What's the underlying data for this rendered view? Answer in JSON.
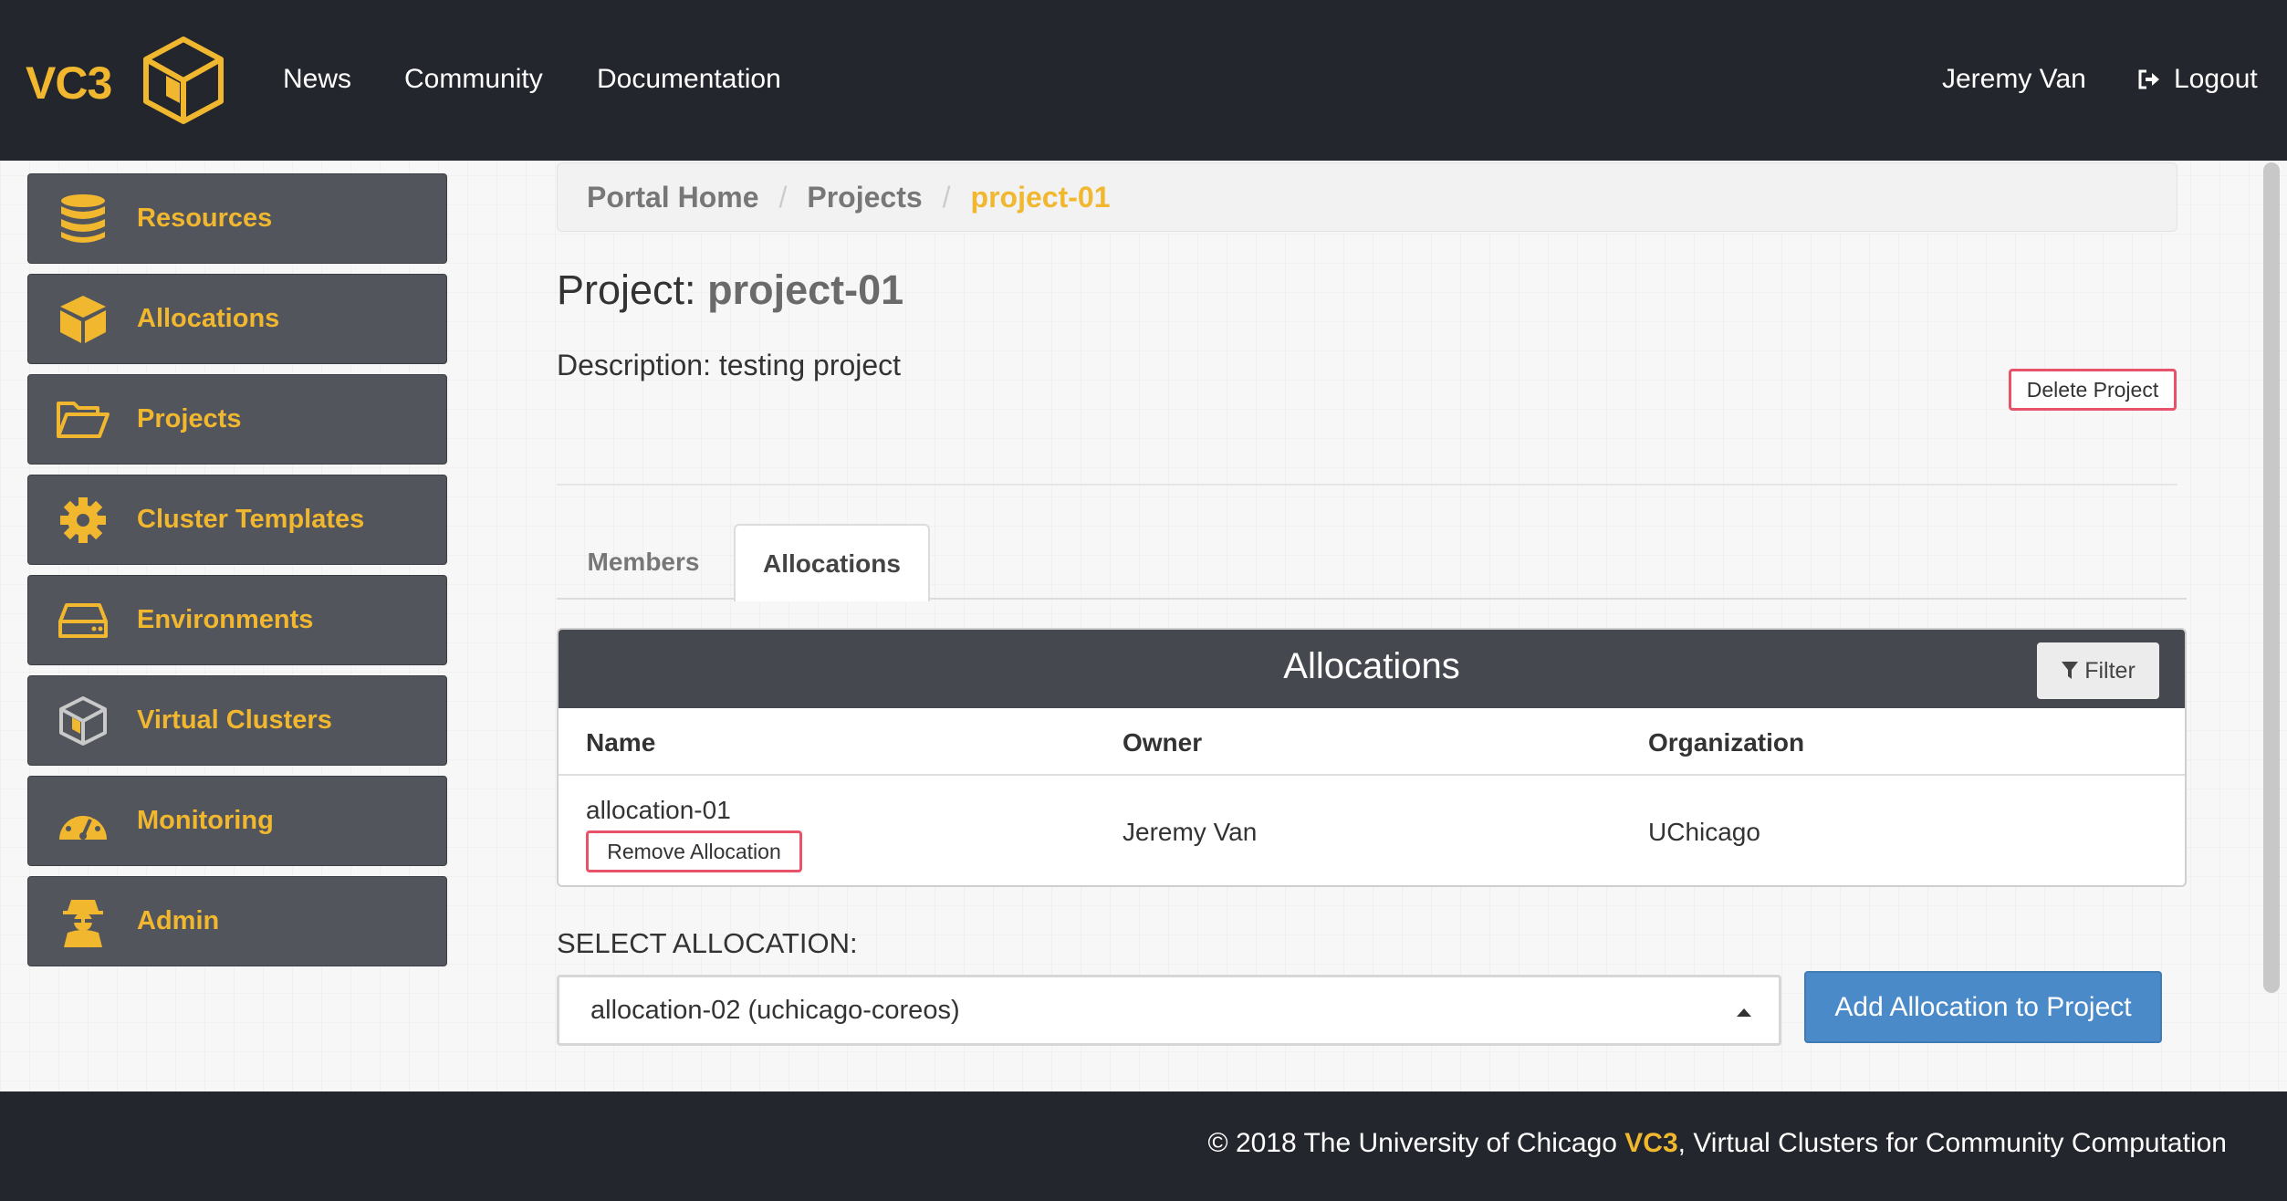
{
  "navbar": {
    "brand": "VC3",
    "links": [
      "News",
      "Community",
      "Documentation"
    ],
    "user": "Jeremy Van",
    "logout": "Logout"
  },
  "sidebar": {
    "items": [
      {
        "label": "Resources",
        "icon": "database-icon"
      },
      {
        "label": "Allocations",
        "icon": "cube-icon"
      },
      {
        "label": "Projects",
        "icon": "folder-open-icon"
      },
      {
        "label": "Cluster Templates",
        "icon": "gear-icon"
      },
      {
        "label": "Environments",
        "icon": "hard-drive-icon"
      },
      {
        "label": "Virtual Clusters",
        "icon": "cluster-cube-icon"
      },
      {
        "label": "Monitoring",
        "icon": "dashboard-gauge-icon"
      },
      {
        "label": "Admin",
        "icon": "user-secret-icon"
      }
    ]
  },
  "breadcrumb": {
    "home": "Portal Home",
    "projects": "Projects",
    "current": "project-01",
    "separator": "/"
  },
  "project": {
    "title_prefix": "Project:",
    "name": "project-01",
    "description": "Description: testing project",
    "delete_label": "Delete Project"
  },
  "tabs": {
    "members": "Members",
    "allocations": "Allocations",
    "active": "Allocations"
  },
  "allocations_panel": {
    "title": "Allocations",
    "filter_label": "Filter",
    "columns": [
      "Name",
      "Owner",
      "Organization"
    ],
    "rows": [
      {
        "name": "allocation-01",
        "owner": "Jeremy Van",
        "organization": "UChicago",
        "remove_label": "Remove Allocation"
      }
    ]
  },
  "select_allocation": {
    "label": "SELECT ALLOCATION:",
    "value": "allocation-02 (uchicago-coreos)",
    "add_label": "Add Allocation to Project"
  },
  "footer": {
    "prefix": "© 2018 The University of Chicago",
    "brand": "VC3",
    "suffix": ", Virtual Clusters for Community Computation"
  },
  "colors": {
    "accent": "#f0b72f",
    "navbar": "#23262c",
    "sidebar_item": "#52555c",
    "primary_button": "#4a8ac9",
    "danger_outline": "#e9536a"
  }
}
